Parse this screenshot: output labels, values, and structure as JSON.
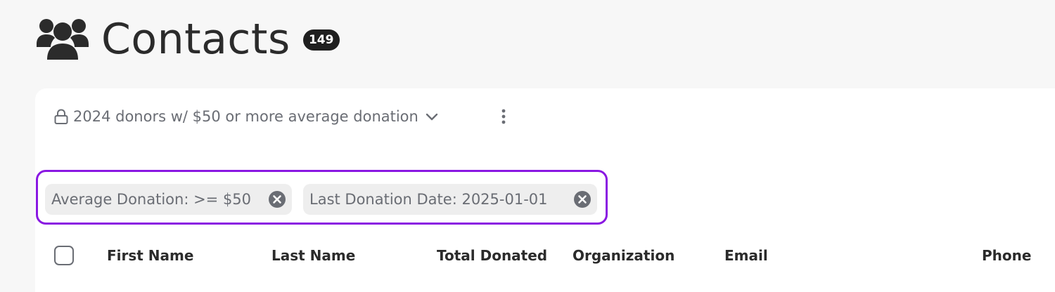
{
  "header": {
    "title": "Contacts",
    "count": "149",
    "icon": "people-group-icon"
  },
  "segment": {
    "label": "2024 donors w/ $50 or more average donation",
    "lock_icon": "lock-icon",
    "dropdown_icon": "chevron-down-icon",
    "menu_icon": "kebab-menu-icon"
  },
  "filters": [
    {
      "label": "Average Donation: >= $50",
      "remove_icon": "close-circle-icon"
    },
    {
      "label": "Last Donation Date: 2025-01-01",
      "remove_icon": "close-circle-icon"
    }
  ],
  "table": {
    "columns": [
      "First Name",
      "Last Name",
      "Total Donated",
      "Organization",
      "Email",
      "Phone"
    ]
  },
  "colors": {
    "background": "#f7f7f7",
    "card": "#ffffff",
    "highlight_border": "#8a18e2",
    "chip_background": "#eeeeee",
    "muted_text": "#6a6d74",
    "text": "#2b2b2b",
    "badge": "#1f1f1f"
  }
}
